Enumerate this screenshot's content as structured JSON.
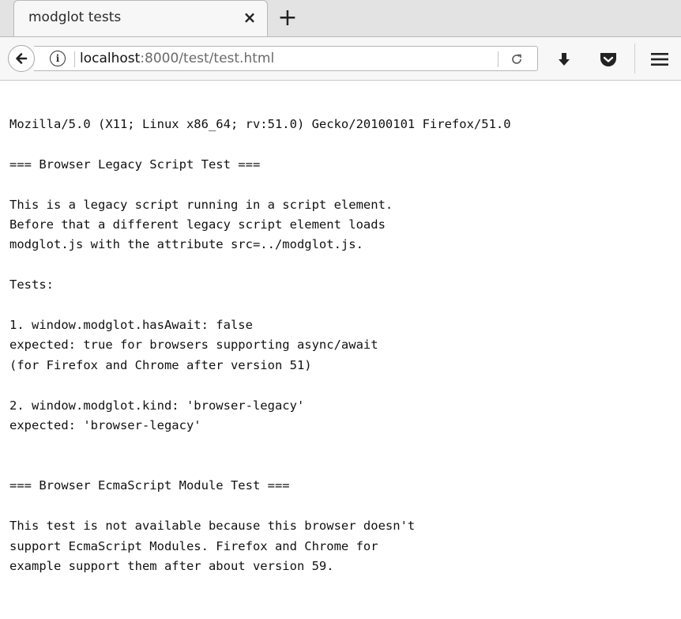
{
  "browser": {
    "tab": {
      "title": "modglot tests",
      "close_glyph": "×"
    },
    "new_tab_glyph": "+",
    "urlbar": {
      "host": "localhost",
      "path": ":8000/test/test.html"
    },
    "reload_glyph": "↻"
  },
  "page": {
    "user_agent": "Mozilla/5.0 (X11; Linux x86_64; rv:51.0) Gecko/20100101 Firefox/51.0",
    "legacy_heading": "=== Browser Legacy Script Test ===",
    "legacy_description": "This is a legacy script running in a script element.\nBefore that a different legacy script element loads\nmodglot.js with the attribute src=../modglot.js.",
    "tests_label": "Tests:",
    "test1": "1. window.modglot.hasAwait: false\nexpected: true for browsers supporting async/await\n(for Firefox and Chrome after version 51)",
    "test2": "2. window.modglot.kind: 'browser-legacy'\nexpected: 'browser-legacy'",
    "module_heading": "=== Browser EcmaScript Module Test ===",
    "module_description": "This test is not available because this browser doesn't\nsupport EcmaScript Modules. Firefox and Chrome for\nexample support them after about version 59."
  }
}
